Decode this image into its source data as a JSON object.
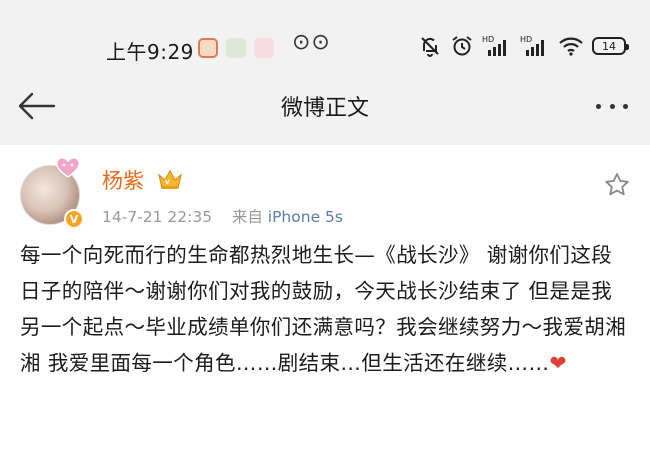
{
  "status_bar": {
    "time": "上午9:29",
    "notification_icons": [
      "notif-app-icon",
      "notif-app-icon",
      "notif-app-icon"
    ],
    "overflow": "⊙⊙",
    "system_icons": [
      "mute-bell-icon",
      "alarm-icon",
      "hd-signal-icon",
      "hd-signal-icon",
      "wifi-icon"
    ],
    "battery": "14"
  },
  "nav": {
    "title": "微博正文"
  },
  "post": {
    "author": "杨紫",
    "avatar_badge": "V",
    "date": "14-7-21 22:35",
    "source_prefix": "来自",
    "source": "iPhone 5s",
    "text": "每一个向死而行的生命都热烈地生长—《战长沙》 谢谢你们这段日子的陪伴～谢谢你们对我的鼓励，今天战长沙结束了 但是是我另一个起点～毕业成绩单你们还满意吗？我会继续努力～我爱胡湘湘 我爱里面每一个角色……剧结束…但生活还在继续……",
    "emoji": "❤"
  },
  "colors": {
    "author_name": "#e86b1c",
    "meta_gray": "#9a9a9a",
    "source_blue": "#5b7ea8",
    "heart_red": "#e0403a"
  }
}
